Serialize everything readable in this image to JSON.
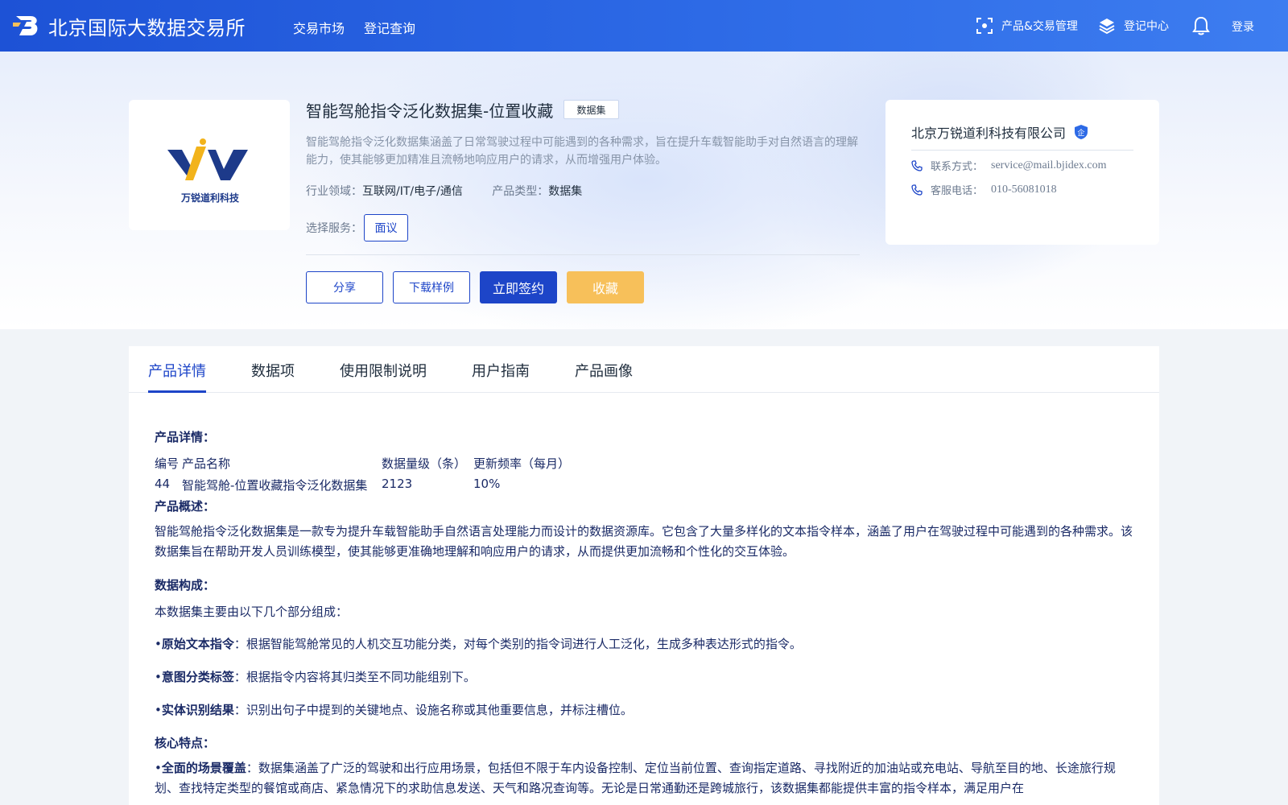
{
  "header": {
    "brand": "北京国际大数据交易所",
    "nav": [
      "交易市场",
      "登记查询"
    ],
    "product_mgmt": "产品&交易管理",
    "register_center": "登记中心",
    "login": "登录"
  },
  "product": {
    "title": "智能驾舱指令泛化数据集-位置收藏",
    "type_tag": "数据集",
    "description": "智能驾舱指令泛化数据集涵盖了日常驾驶过程中可能遇到的各种需求，旨在提升车载智能助手对自然语言的理解能力，使其能够更加精准且流畅地响应用户的请求，从而增强用户体验。",
    "industry_label": "行业领域：",
    "industry_value": "互联网/IT/电子/通信",
    "product_type_label": "产品类型：",
    "product_type_value": "数据集",
    "service_label": "选择服务：",
    "service_option": "面议",
    "logo_caption": "万锐道利科技"
  },
  "actions": {
    "share": "分享",
    "download_sample": "下载样例",
    "sign_now": "立即签约",
    "favorite": "收藏"
  },
  "vendor": {
    "name": "北京万锐道利科技有限公司",
    "badge": "企",
    "contact_label": "联系方式：",
    "contact_value": "service@mail.bjidex.com",
    "phone_label": "客服电话：",
    "phone_value": "010-56081018"
  },
  "tabs": [
    "产品详情",
    "数据项",
    "使用限制说明",
    "用户指南",
    "产品画像"
  ],
  "detail": {
    "heading": "产品详情：",
    "table_headers": [
      "编号",
      "产品名称",
      "数据量级（条）",
      "更新频率（每月）"
    ],
    "table_row": [
      "44",
      "智能驾舱-位置收藏指令泛化数据集",
      "2123",
      "10%"
    ],
    "overview_heading": "产品概述：",
    "overview_text": "智能驾舱指令泛化数据集是一款专为提升车载智能助手自然语言处理能力而设计的数据资源库。它包含了大量多样化的文本指令样本，涵盖了用户在驾驶过程中可能遇到的各种需求。该数据集旨在帮助开发人员训练模型，使其能够更准确地理解和响应用户的请求，从而提供更加流畅和个性化的交互体验。",
    "composition_heading": "数据构成：",
    "composition_intro": "本数据集主要由以下几个部分组成：",
    "composition_items": [
      {
        "term": "原始文本指令",
        "text": "：根据智能驾舱常见的人机交互功能分类，对每个类别的指令词进行人工泛化，生成多种表达形式的指令。"
      },
      {
        "term": "意图分类标签",
        "text": "：根据指令内容将其归类至不同功能组别下。"
      },
      {
        "term": "实体识别结果",
        "text": "：识别出句子中提到的关键地点、设施名称或其他重要信息，并标注槽位。"
      }
    ],
    "features_heading": "核心特点：",
    "feature_term": "全面的场景覆盖",
    "feature_text": "：数据集涵盖了广泛的驾驶和出行应用场景，包括但不限于车内设备控制、定位当前位置、查询指定道路、寻找附近的加油站或充电站、导航至目的地、长途旅行规划、查找特定类型的餐馆或商店、紧急情况下的求助信息发送、天气和路况查询等。无论是日常通勤还是跨城旅行，该数据集都能提供丰富的指令样本，满足用户在"
  },
  "colors": {
    "header_blue": "#1d52d6",
    "primary": "#1d45c8",
    "favorite": "#f7c05a",
    "logo_yellow": "#f2b31b",
    "logo_navy": "#1d3a8a"
  },
  "icons": [
    "logo-icon",
    "scan-icon",
    "layers-icon",
    "bell-icon",
    "shield-badge-icon",
    "phone-icon"
  ]
}
